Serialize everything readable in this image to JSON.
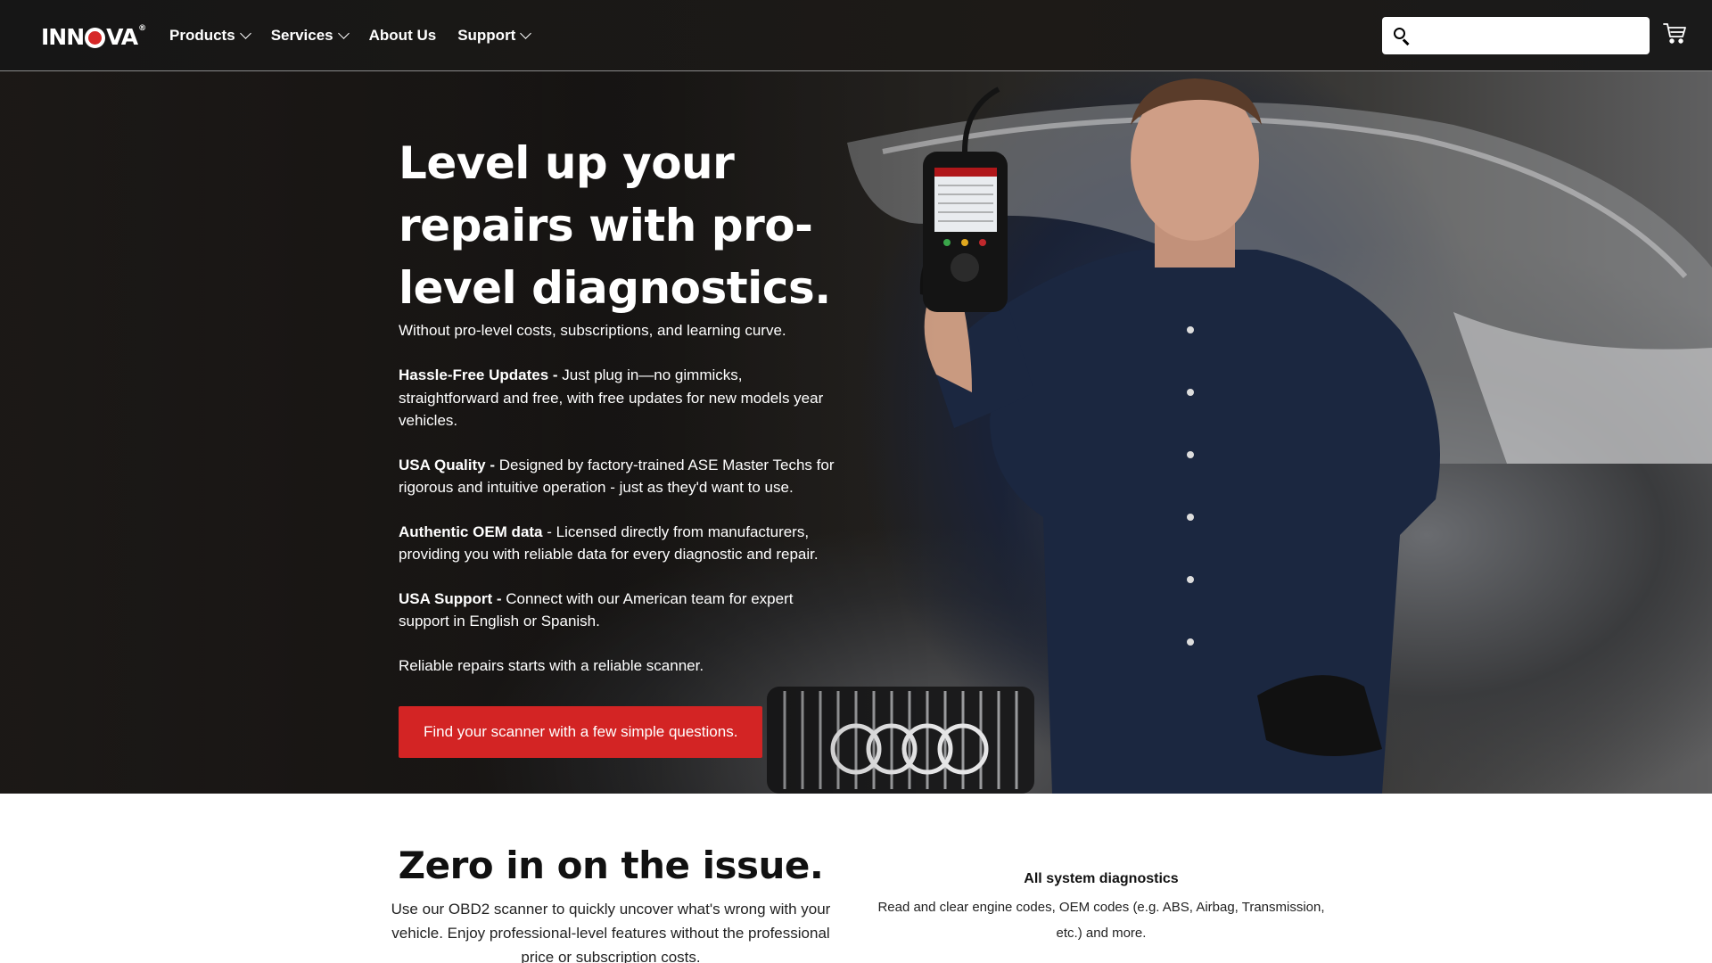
{
  "header": {
    "logo_text_left": "INN",
    "logo_text_right": "VA",
    "logo_reg": "®",
    "nav": [
      {
        "label": "Products",
        "has_dropdown": true
      },
      {
        "label": "Services",
        "has_dropdown": true
      },
      {
        "label": "About Us",
        "has_dropdown": false
      },
      {
        "label": "Support",
        "has_dropdown": true
      }
    ],
    "search": {
      "placeholder": "",
      "value": "",
      "icon": "search-icon"
    },
    "cart_icon": "cart-icon"
  },
  "hero": {
    "title": "Level up your repairs with pro-level diagnostics.",
    "subtitle": "Without pro-level costs, subscriptions, and learning curve.",
    "features": [
      {
        "label": "Hassle-Free Updates -",
        "text": " Just plug in—no gimmicks, straightforward and free, with free updates for new models year vehicles."
      },
      {
        "label": "USA Quality -",
        "text": " Designed by factory-trained ASE Master Techs for rigorous and intuitive operation - just as they'd want to use."
      },
      {
        "label": "Authentic OEM data",
        "text": " - Licensed directly from manufacturers, providing you with reliable data for every diagnostic and repair."
      },
      {
        "label": "USA Support -",
        "text": " Connect with our American team for expert support in English or Spanish."
      }
    ],
    "closing": "Reliable repairs starts with a reliable scanner.",
    "cta_label": "Find your scanner with a few simple questions."
  },
  "section": {
    "title": "Zero in on the issue.",
    "text": "Use our OBD2 scanner to quickly uncover what's wrong with your vehicle. Enjoy professional-level features without the professional price or subscription costs.",
    "feature_title": "All system diagnostics",
    "feature_text": "Read and clear engine codes, OEM codes (e.g. ABS, Airbag, Transmission, etc.) and more."
  },
  "colors": {
    "accent_red": "#d32424",
    "header_bg": "#161616",
    "text_white": "#ffffff"
  }
}
